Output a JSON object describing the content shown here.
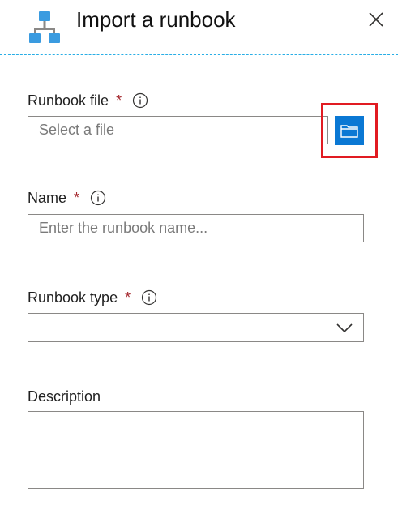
{
  "header": {
    "title": "Import a runbook",
    "icon": "runbook-hierarchy-icon",
    "close_icon": "close-icon"
  },
  "form": {
    "runbook_file": {
      "label": "Runbook file",
      "required_mark": "*",
      "placeholder": "Select a file",
      "value": "",
      "browse_icon": "folder-icon"
    },
    "name": {
      "label": "Name",
      "required_mark": "*",
      "placeholder": "Enter the runbook name...",
      "value": ""
    },
    "runbook_type": {
      "label": "Runbook type",
      "required_mark": "*",
      "selected": ""
    },
    "description": {
      "label": "Description",
      "value": ""
    }
  },
  "colors": {
    "accent": "#0a78d4",
    "required": "#a4262c",
    "highlight": "#e11b22",
    "divider": "#29aee6",
    "icon": "#3a9be0"
  }
}
